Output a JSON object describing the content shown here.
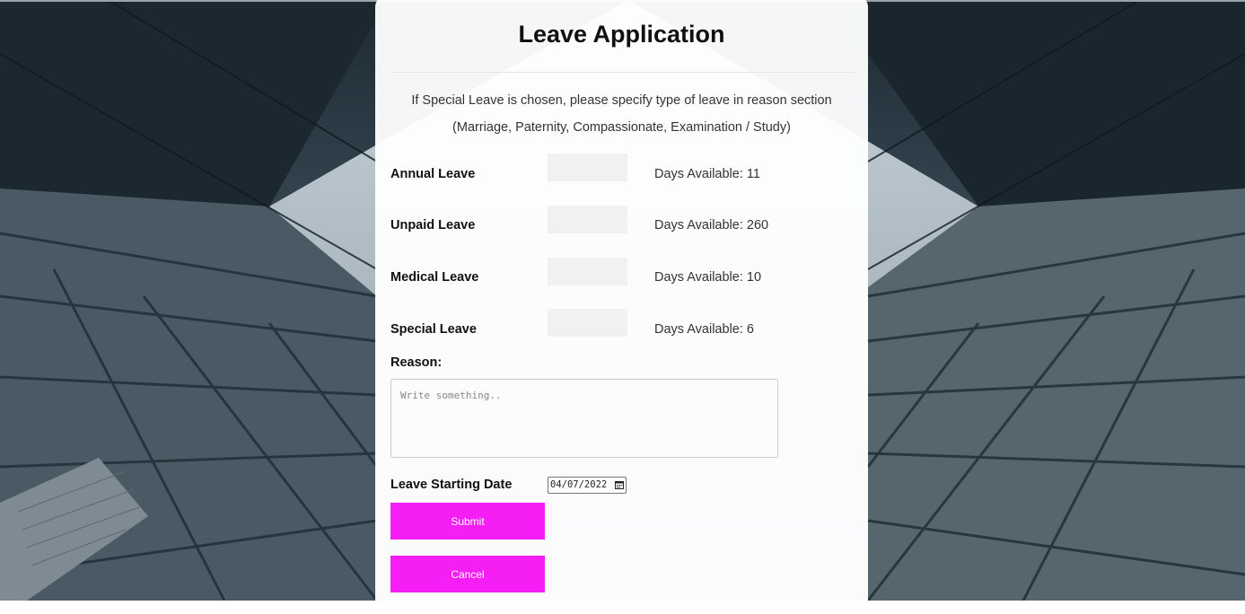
{
  "form": {
    "title": "Leave Application",
    "note_line1": "If Special Leave is chosen, please specify type of leave in reason section",
    "note_line2": "(Marriage, Paternity, Compassionate, Examination / Study)",
    "leave_types": [
      {
        "label": "Annual Leave",
        "available_text": "Days Available: 11",
        "days_available": 11,
        "value": ""
      },
      {
        "label": "Unpaid Leave",
        "available_text": "Days Available: 260",
        "days_available": 260,
        "value": ""
      },
      {
        "label": "Medical Leave",
        "available_text": "Days Available: 10",
        "days_available": 10,
        "value": ""
      },
      {
        "label": "Special Leave",
        "available_text": "Days Available: 6",
        "days_available": 6,
        "value": ""
      }
    ],
    "reason_label": "Reason:",
    "reason_placeholder": "Write something..",
    "reason_value": "",
    "start_date_label": "Leave Starting Date",
    "start_date_value": "04/07/2022",
    "submit_label": "Submit",
    "cancel_label": "Cancel"
  },
  "icons": {
    "date_picker": "calendar-icon"
  },
  "colors": {
    "button": "#f51ff5",
    "button_text": "#ffffff",
    "input_bg": "#f1f1f1",
    "card_bg": "#ffffff"
  }
}
